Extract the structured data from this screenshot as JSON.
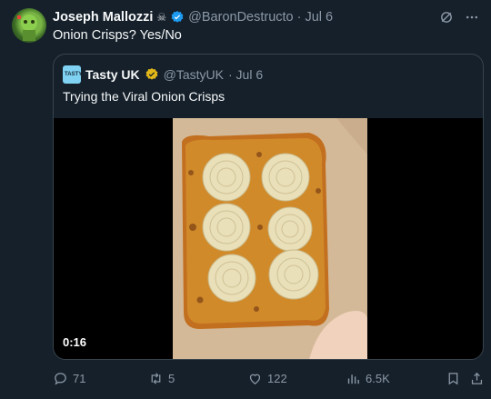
{
  "post": {
    "author_name": "Joseph Mallozzi",
    "author_emoji": "☠",
    "handle": "@BaronDestructo",
    "date": "· Jul 6",
    "text": "Onion Crisps?  Yes/No"
  },
  "quote": {
    "logo_text": "TASTY UK",
    "author_name": "Tasty UK",
    "handle": "@TastyUK",
    "date": "· Jul 6",
    "text": "Trying the Viral Onion Crisps",
    "video_duration": "0:16"
  },
  "actions": {
    "replies": "71",
    "reposts": "5",
    "likes": "122",
    "views": "6.5K"
  },
  "colors": {
    "background": "#15202b",
    "verified_blue": "#1d9bf0",
    "verified_gold": "#e2b719",
    "muted": "#8b98a5"
  },
  "icons": [
    "grok-icon",
    "more-icon",
    "reply-icon",
    "repost-icon",
    "like-icon",
    "views-icon",
    "bookmark-icon",
    "share-icon"
  ]
}
